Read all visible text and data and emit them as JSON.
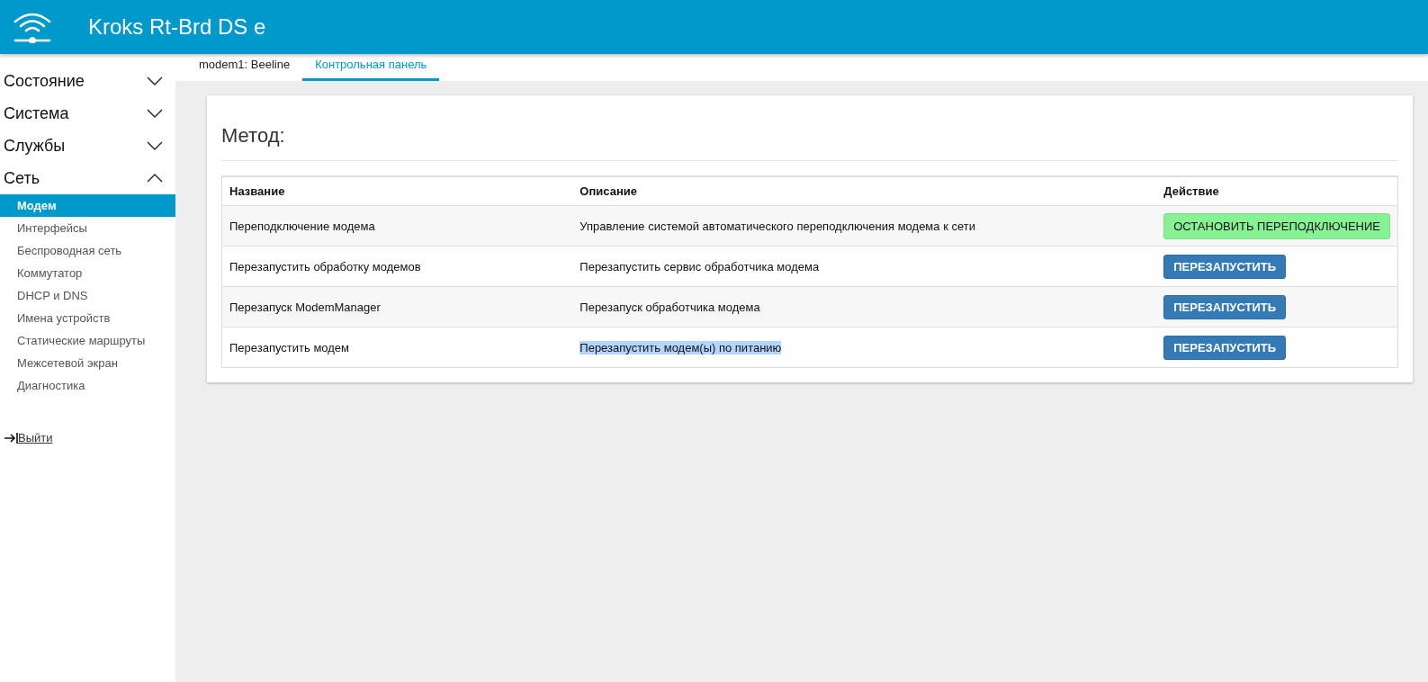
{
  "header": {
    "title": "Kroks Rt-Brd DS e"
  },
  "sidebar": {
    "sections": [
      {
        "label": "Состояние",
        "expanded": false
      },
      {
        "label": "Система",
        "expanded": false
      },
      {
        "label": "Службы",
        "expanded": false
      },
      {
        "label": "Сеть",
        "expanded": true,
        "children": [
          {
            "label": "Модем",
            "selected": true
          },
          {
            "label": "Интерфейсы",
            "selected": false
          },
          {
            "label": "Беспроводная сеть",
            "selected": false
          },
          {
            "label": "Коммутатор",
            "selected": false
          },
          {
            "label": "DHCP и DNS",
            "selected": false
          },
          {
            "label": "Имена устройств",
            "selected": false
          },
          {
            "label": "Статические маршруты",
            "selected": false
          },
          {
            "label": "Межсетевой экран",
            "selected": false
          },
          {
            "label": "Диагностика",
            "selected": false
          }
        ]
      }
    ],
    "logout": "Выйти"
  },
  "tabs": [
    {
      "label": "modem1: Beeline",
      "selected": false
    },
    {
      "label": "Контрольная панель",
      "selected": true
    }
  ],
  "card": {
    "title": "Метод:",
    "columns": [
      "Название",
      "Описание",
      "Действие"
    ],
    "rows": [
      {
        "name": "Переподключение модема",
        "description": "Управление системой автоматического переподключения модема к сети",
        "description_highlighted": false,
        "action": {
          "kind": "success",
          "label": "ОСТАНОВИТЬ ПЕРЕПОДКЛЮЧЕНИЕ"
        }
      },
      {
        "name": "Перезапустить обработку модемов",
        "description": "Перезапустить сервис обработчика модема",
        "description_highlighted": false,
        "action": {
          "kind": "primary",
          "label": "ПЕРЕЗАПУСТИТЬ"
        }
      },
      {
        "name": "Перезапуск ModemManager",
        "description": "Перезапуск обработчика модема",
        "description_highlighted": false,
        "action": {
          "kind": "primary",
          "label": "ПЕРЕЗАПУСТИТЬ"
        }
      },
      {
        "name": "Перезапустить модем",
        "description": "Перезапустить модем(ы) по питанию",
        "description_highlighted": true,
        "action": {
          "kind": "primary",
          "label": "ПЕРЕЗАПУСТИТЬ"
        }
      }
    ]
  }
}
